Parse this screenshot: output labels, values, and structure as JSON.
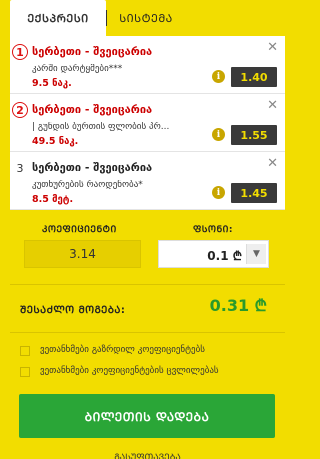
{
  "tabs": {
    "active": "ᲔᲥᲡᲞᲠᲔᲡᲘ",
    "system": "ᲡᲘᲡᲢᲔᲛᲐ"
  },
  "bets": [
    {
      "number": "1",
      "title": "სერბეთი - შვეიცარია",
      "market": "კარში დარტყმები***",
      "time": "9.5 ნაკ.",
      "odd": "1.40",
      "info_icon": "info-icon",
      "close_icon": "close-icon"
    },
    {
      "number": "2",
      "title": "სერბეთი - შვეიცარია",
      "market": "| გუნდის ბურთის ფლობის პრ...",
      "time": "49.5 ნაკ.",
      "odd": "1.55",
      "info_icon": "info-icon",
      "close_icon": "close-icon"
    },
    {
      "number": "3",
      "title": "სერბეთი - შვეიცარია",
      "market": "კუთხურების რაოდენობა*",
      "time": "8.5 მეტ.",
      "odd": "1.45",
      "info_icon": "info-icon",
      "close_icon": "close-icon"
    }
  ],
  "summary": {
    "coef_label": "ᲙᲝᲔᲤᲘᲪᲘᲔᲜᲢᲘ",
    "coef_value": "3.14",
    "stake_label": "ᲤᲡᲝᲜᲘ:",
    "stake_value": "0.1 ₾",
    "win_label": "ᲨᲔᲡᲐᲫᲚᲝ ᲛᲝᲒᲔᲑᲐ:",
    "win_value": "0.31 ₾"
  },
  "options": {
    "accept_higher": "ვეთანხმები გაზრდილ კოეფიციენტებს",
    "accept_changes": "ვეთანხმები კოეფიციენტების ცვლილებას"
  },
  "place_button": "ᲑᲘᲚᲔᲗᲘᲡ ᲓᲐᲓᲔᲑᲐ",
  "bottom_text": "ᲒᲐᲡᲣᲤᲗᲐᲕᲔᲑᲐ",
  "colors": {
    "brand_yellow": "#f2dd00",
    "odd_bg": "#3a3a3a",
    "win_green": "#2a9a2a",
    "button_green": "#2aa637",
    "accent_red": "#c00"
  }
}
